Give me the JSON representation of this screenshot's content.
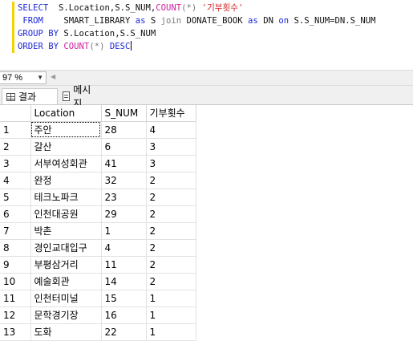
{
  "editor": {
    "lines": [
      [
        {
          "t": "SELECT",
          "c": "kw"
        },
        {
          "t": "  S.Location,S.S_NUM,",
          "c": "id"
        },
        {
          "t": "COUNT",
          "c": "fn"
        },
        {
          "t": "(*)",
          "c": "op"
        },
        {
          "t": " '기부횟수'",
          "c": "str"
        }
      ],
      [
        {
          "t": " FROM",
          "c": "kw"
        },
        {
          "t": "    SMART_LIBRARY ",
          "c": "id"
        },
        {
          "t": "as",
          "c": "kw"
        },
        {
          "t": " S ",
          "c": "id"
        },
        {
          "t": "join",
          "c": "op"
        },
        {
          "t": " DONATE_BOOK ",
          "c": "id"
        },
        {
          "t": "as",
          "c": "kw"
        },
        {
          "t": " DN ",
          "c": "id"
        },
        {
          "t": "on",
          "c": "kw"
        },
        {
          "t": " S.S_NUM=DN.S_NUM",
          "c": "id"
        }
      ],
      [
        {
          "t": "GROUP BY",
          "c": "kw"
        },
        {
          "t": " S.Location,S.S_NUM",
          "c": "id"
        }
      ],
      [
        {
          "t": "ORDER BY",
          "c": "kw"
        },
        {
          "t": " ",
          "c": "id"
        },
        {
          "t": "COUNT",
          "c": "fn"
        },
        {
          "t": "(*)",
          "c": "op"
        },
        {
          "t": " ",
          "c": "id"
        },
        {
          "t": "DESC",
          "c": "kw"
        }
      ]
    ],
    "colors": {
      "keyword": "#1d27d6",
      "function": "#d0219e",
      "string": "#d21f1f",
      "operator": "#7a7a7a"
    }
  },
  "zoom": {
    "value": "97 %",
    "arrow_icon": "chevron-down-icon"
  },
  "tabs": {
    "results_label": "결과",
    "messages_label": "메시지",
    "results_icon": "grid-icon",
    "messages_icon": "message-icon"
  },
  "grid": {
    "columns": [
      "Location",
      "S_NUM",
      "기부횟수"
    ],
    "rows": [
      [
        "1",
        "주안",
        "28",
        "4"
      ],
      [
        "2",
        "갈산",
        "6",
        "3"
      ],
      [
        "3",
        "서부여성회관",
        "41",
        "3"
      ],
      [
        "4",
        "완정",
        "32",
        "2"
      ],
      [
        "5",
        "테크노파크",
        "23",
        "2"
      ],
      [
        "6",
        "인천대공원",
        "29",
        "2"
      ],
      [
        "7",
        "박촌",
        "1",
        "2"
      ],
      [
        "8",
        "경인교대입구",
        "4",
        "2"
      ],
      [
        "9",
        "부평삼거리",
        "11",
        "2"
      ],
      [
        "10",
        "예술회관",
        "14",
        "2"
      ],
      [
        "11",
        "인천터미널",
        "15",
        "1"
      ],
      [
        "12",
        "문학경기장",
        "16",
        "1"
      ],
      [
        "13",
        "도화",
        "22",
        "1"
      ]
    ]
  }
}
